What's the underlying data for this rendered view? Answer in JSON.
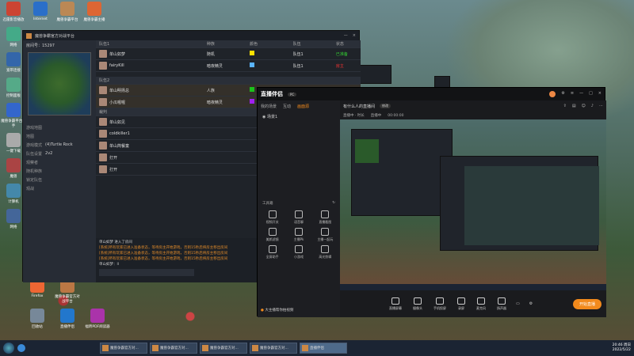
{
  "desktop_icons": [
    {
      "label": "迅雷影音播放",
      "color": "#c43"
    },
    {
      "label": "Internet",
      "color": "#2a6fc9"
    },
    {
      "label": "魔兽争霸平台",
      "color": "#b85"
    },
    {
      "label": "魔兽争霸主播",
      "color": "#d63"
    },
    {
      "label": "网络",
      "color": "#4a8"
    },
    {
      "label": "宽带连接",
      "color": "#36a"
    },
    {
      "label": "控制面板",
      "color": "#5a8"
    },
    {
      "label": "魔兽争霸平台助手",
      "color": "#36c"
    },
    {
      "label": "一键下载",
      "color": "#aaa"
    },
    {
      "label": "魔兽",
      "color": "#a44"
    },
    {
      "label": "计算机",
      "color": "#48a"
    },
    {
      "label": "网络",
      "color": "#469"
    },
    {
      "label": "Firefox",
      "color": "#e63"
    },
    {
      "label": "魔兽争霸官方对战平台",
      "color": "#b74"
    },
    {
      "label": "回收站",
      "color": "#789"
    },
    {
      "label": "直播伴侣",
      "color": "#27c"
    },
    {
      "label": "福昕PDF阅读器",
      "color": "#a3a"
    }
  ],
  "game_window": {
    "title": "魔兽争霸官方对战平台",
    "room_label": "房间号：15297",
    "settings": [
      {
        "k": "游戏地图",
        "v": ""
      },
      {
        "k": "地图",
        "v": ""
      },
      {
        "k": "游戏模式",
        "v": "(4)Turtle Rock"
      },
      {
        "k": "队伍设置",
        "v": "2v2"
      },
      {
        "k": "观察者",
        "v": ""
      },
      {
        "k": "随机种族",
        "v": ""
      },
      {
        "k": "锁定队伍",
        "v": ""
      },
      {
        "k": "观战",
        "v": ""
      }
    ],
    "headers": [
      "队伍1",
      "种族",
      "颜色",
      "队伍",
      "状态"
    ],
    "team1": [
      {
        "name": "单山如梦",
        "race": "随机",
        "color": "#ffe000",
        "team": "队伍1",
        "status": "已准备",
        "status_color": "#3c3"
      },
      {
        "name": "fairyKill",
        "race": "暗夜精灵",
        "color": "#5ab4ff",
        "team": "队伍1",
        "status": "房主",
        "status_color": "#e33"
      }
    ],
    "team2_header": "队伍2",
    "team2": [
      {
        "name": "单山明扬总",
        "race": "人族",
        "color": "#1bc11b",
        "team": "队伍2",
        "status": "",
        "status_color": "#3c3"
      },
      {
        "name": "小瓜喔喔",
        "race": "暗夜精灵",
        "color": "#a020f0",
        "team": "队伍2",
        "status": "",
        "status_color": "#3c3"
      }
    ],
    "observers_header": "裁判",
    "observers": [
      "单山如见",
      "coldkiller1",
      "单山简餐童",
      "打开",
      "打开"
    ],
    "chat_lines": [
      {
        "text": "单山如梦 进入了房间",
        "warn": false
      },
      {
        "text": "[系统]所有玩家已进入准备状态，等待房主开始游戏，否则15秒后将房主移出房间",
        "warn": true
      },
      {
        "text": "[系统]所有玩家已进入准备状态，等待房主开始游戏，否则15秒后将房主移出房间",
        "warn": true
      },
      {
        "text": "[系统]所有玩家已进入准备状态，等待房主开始游戏，否则15秒后将房主移出房间",
        "warn": true
      },
      {
        "text": "单山如梦：ll",
        "warn": false
      }
    ]
  },
  "stream_window": {
    "logo": "直播伴侣",
    "tabs": [
      "我的场景",
      "互动",
      "画面源"
    ],
    "scene": "场景1",
    "tools_title": "工具箱",
    "tools": [
      "视频开关",
      "语音聊",
      "直播截图",
      "美颜滤镜",
      "主播Pk",
      "主播一起玩",
      "全屏助手",
      "小游戏",
      "高光剪辑"
    ],
    "room_title": "有什么人的直播间",
    "title_tag": "修改",
    "meta": [
      "直播中 · 时长",
      "直播中",
      "00:00:00"
    ],
    "bottom_buttons": [
      "直播屏幕",
      "摄像头",
      "手机投屏",
      "录屏",
      "麦克风",
      "扬声器"
    ],
    "golive": "开始直播",
    "footer": "大主播帮你拍视频"
  },
  "taskbar": {
    "buttons": [
      "魔兽争霸官方对...",
      "魔兽争霸官方对...",
      "魔兽争霸官方对...",
      "魔兽争霸官方对...",
      "直播伴侣"
    ],
    "time": "20:46 周日",
    "date": "2022/5/22"
  }
}
